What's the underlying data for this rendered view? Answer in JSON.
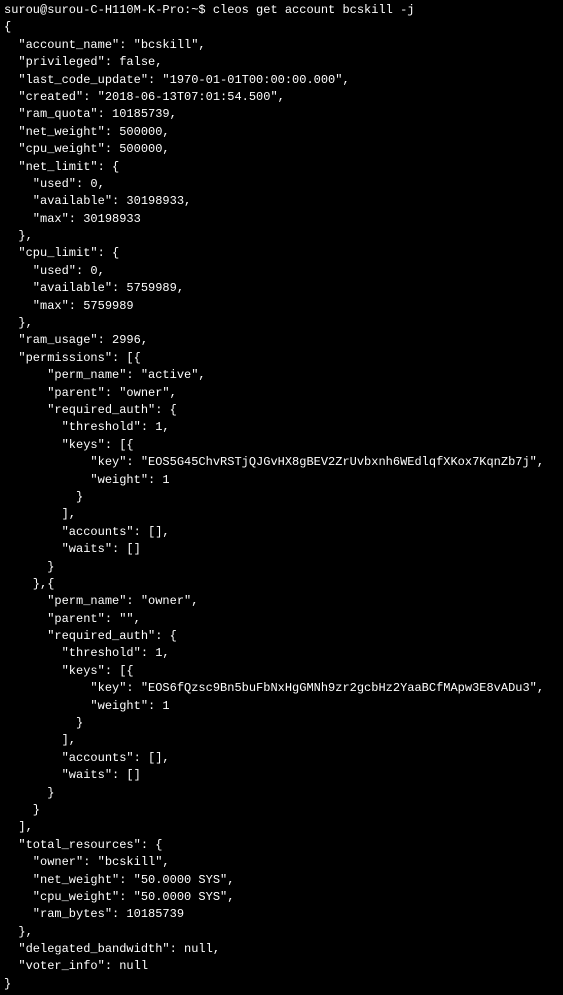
{
  "prompt": "surou@surou-C-H110M-K-Pro:~$ cleos get account bcskill -j",
  "json_output": "{\n  \"account_name\": \"bcskill\",\n  \"privileged\": false,\n  \"last_code_update\": \"1970-01-01T00:00:00.000\",\n  \"created\": \"2018-06-13T07:01:54.500\",\n  \"ram_quota\": 10185739,\n  \"net_weight\": 500000,\n  \"cpu_weight\": 500000,\n  \"net_limit\": {\n    \"used\": 0,\n    \"available\": 30198933,\n    \"max\": 30198933\n  },\n  \"cpu_limit\": {\n    \"used\": 0,\n    \"available\": 5759989,\n    \"max\": 5759989\n  },\n  \"ram_usage\": 2996,\n  \"permissions\": [{\n      \"perm_name\": \"active\",\n      \"parent\": \"owner\",\n      \"required_auth\": {\n        \"threshold\": 1,\n        \"keys\": [{\n            \"key\": \"EOS5G45ChvRSTjQJGvHX8gBEV2ZrUvbxnh6WEdlqfXKox7KqnZb7j\",\n            \"weight\": 1\n          }\n        ],\n        \"accounts\": [],\n        \"waits\": []\n      }\n    },{\n      \"perm_name\": \"owner\",\n      \"parent\": \"\",\n      \"required_auth\": {\n        \"threshold\": 1,\n        \"keys\": [{\n            \"key\": \"EOS6fQzsc9Bn5buFbNxHgGMNh9zr2gcbHz2YaaBCfMApw3E8vADu3\",\n            \"weight\": 1\n          }\n        ],\n        \"accounts\": [],\n        \"waits\": []\n      }\n    }\n  ],\n  \"total_resources\": {\n    \"owner\": \"bcskill\",\n    \"net_weight\": \"50.0000 SYS\",\n    \"cpu_weight\": \"50.0000 SYS\",\n    \"ram_bytes\": 10185739\n  },\n  \"delegated_bandwidth\": null,\n  \"voter_info\": null\n}"
}
